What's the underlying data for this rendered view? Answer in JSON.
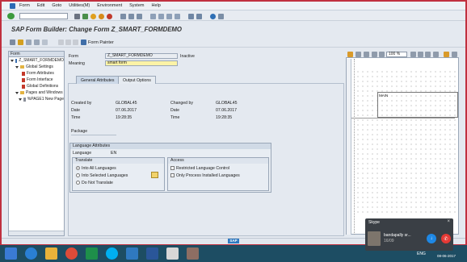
{
  "menu": [
    "Form",
    "Edit",
    "Goto",
    "Utilities(M)",
    "Environment",
    "System",
    "Help"
  ],
  "title": "SAP Form Builder: Change Form Z_SMART_FORMDEMO",
  "toolbar2": {
    "form_painter": "Form Painter"
  },
  "tree": {
    "header": "Form",
    "items": [
      {
        "label": "Z_SMART_FORMDEMO",
        "level": 0,
        "kind": "form"
      },
      {
        "label": "Global Settings",
        "level": 1,
        "kind": "folder"
      },
      {
        "label": "Form Attributes",
        "level": 2,
        "kind": "doc"
      },
      {
        "label": "Form Interface",
        "level": 2,
        "kind": "doc"
      },
      {
        "label": "Global Definitions",
        "level": 2,
        "kind": "doc"
      },
      {
        "label": "Pages and Windows",
        "level": 1,
        "kind": "folder"
      },
      {
        "label": "%PAGE1 New Page",
        "level": 2,
        "kind": "doc"
      }
    ]
  },
  "form": {
    "form_label": "Form",
    "form_value": "Z_SMART_FORMDEMO",
    "status": "Inactive",
    "meaning_label": "Meaning",
    "meaning_value": "smart form"
  },
  "tabs": [
    {
      "label": "General Attributes",
      "active": true
    },
    {
      "label": "Output Options",
      "active": false
    }
  ],
  "general": {
    "created_by_label": "Created by",
    "created_by": "GLOBAL45",
    "date_label": "Date",
    "date": "07.06.2017",
    "time_label": "Time",
    "time": "19:28:35",
    "changed_by_label": "Changed by",
    "changed_by": "GLOBAL45",
    "changed_date": "07.06.2017",
    "changed_time": "19:28:35",
    "package_label": "Package",
    "package_value": ""
  },
  "language": {
    "group_title": "Language Attributes",
    "language_label": "Language",
    "language_value": "EN",
    "translate_title": "Translate",
    "translate_options": [
      {
        "label": "Into All Languages",
        "checked": true
      },
      {
        "label": "Into Selected Languages",
        "checked": false
      },
      {
        "label": "Do Not Translate",
        "checked": false
      }
    ],
    "access_title": "Access",
    "access_options": [
      {
        "label": "Restricted Language Control",
        "checked": false
      },
      {
        "label": "Only Process Installed Languages",
        "checked": false
      }
    ]
  },
  "painter": {
    "zoom": "100 %",
    "window_label": "MAIN"
  },
  "skype": {
    "app": "Skype",
    "caller": "bandapally sr...",
    "subtitle": "16/09"
  },
  "taskbar": {
    "lang": "ENG",
    "time": "04:06",
    "date": "08-06-2017"
  }
}
